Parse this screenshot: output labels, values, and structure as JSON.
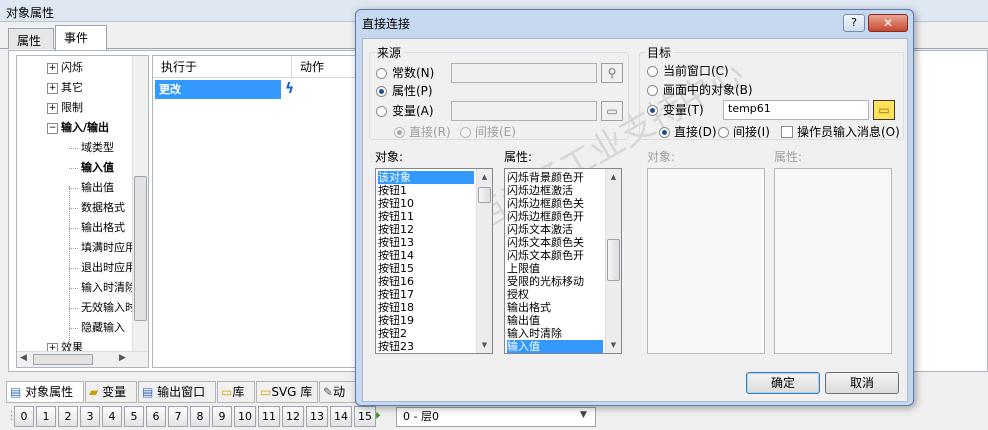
{
  "window": {
    "title": "对象属性"
  },
  "tabs": [
    {
      "label": "属性"
    },
    {
      "label": "事件"
    }
  ],
  "tree": {
    "items": [
      {
        "label": "闪烁",
        "exp": "+"
      },
      {
        "label": "其它",
        "exp": "+"
      },
      {
        "label": "限制",
        "exp": "+"
      },
      {
        "label": "输入/输出",
        "exp": "−"
      },
      {
        "label": "域类型"
      },
      {
        "label": "输入值"
      },
      {
        "label": "输出值"
      },
      {
        "label": "数据格式"
      },
      {
        "label": "输出格式"
      },
      {
        "label": "填满时应用"
      },
      {
        "label": "退出时应用"
      },
      {
        "label": "输入时清除"
      },
      {
        "label": "无效输入时"
      },
      {
        "label": "隐藏输入"
      },
      {
        "label": "效果",
        "exp": "+"
      }
    ]
  },
  "grid": {
    "col_exec": "执行于",
    "col_action": "动作",
    "row_value": "更改"
  },
  "bottom_tabs": [
    {
      "label": "对象属性"
    },
    {
      "label": "变量"
    },
    {
      "label": "输出窗口"
    },
    {
      "label": "库"
    },
    {
      "label": "SVG 库"
    },
    {
      "label": "动"
    }
  ],
  "layers": {
    "buttons": [
      "0",
      "1",
      "2",
      "3",
      "4",
      "5",
      "6",
      "7",
      "8",
      "9",
      "10",
      "11",
      "12",
      "13",
      "14",
      "15"
    ],
    "selected": "0 - 层0"
  },
  "dialog": {
    "title": "直接连接",
    "help": "?",
    "source": {
      "label": "来源",
      "constant": "常数(N)",
      "property": "属性(P)",
      "variable": "变量(A)",
      "direct": "直接(R)",
      "indirect": "间接(E)"
    },
    "target": {
      "label": "目标",
      "current_window": "当前窗口(C)",
      "object_in_screen": "画面中的对象(B)",
      "variable": "变量(T)",
      "variable_value": "temp61",
      "direct": "直接(D)",
      "indirect": "间接(I)",
      "operator_msg": "操作员输入消息(O)"
    },
    "objects_label": "对象:",
    "objects": [
      "该对象",
      "按钮1",
      "按钮10",
      "按钮11",
      "按钮12",
      "按钮13",
      "按钮14",
      "按钮15",
      "按钮16",
      "按钮17",
      "按钮18",
      "按钮19",
      "按钮2",
      "按钮23"
    ],
    "properties_label": "属性:",
    "properties": [
      "闪烁背景颜色开",
      "闪烁边框激活",
      "闪烁边框颜色关",
      "闪烁边框颜色开",
      "闪烁文本激活",
      "闪烁文本颜色关",
      "闪烁文本颜色开",
      "上限值",
      "受限的光标移动",
      "授权",
      "输出格式",
      "输出值",
      "输入时清除",
      "输入值"
    ],
    "target_object_label": "对象:",
    "target_property_label": "属性:",
    "ok": "确定",
    "cancel": "取消"
  },
  "colors": {
    "selection": "#3399ff",
    "dialog_frame": "#c5d8f0",
    "accent_bolt": "#1a5fd0"
  }
}
